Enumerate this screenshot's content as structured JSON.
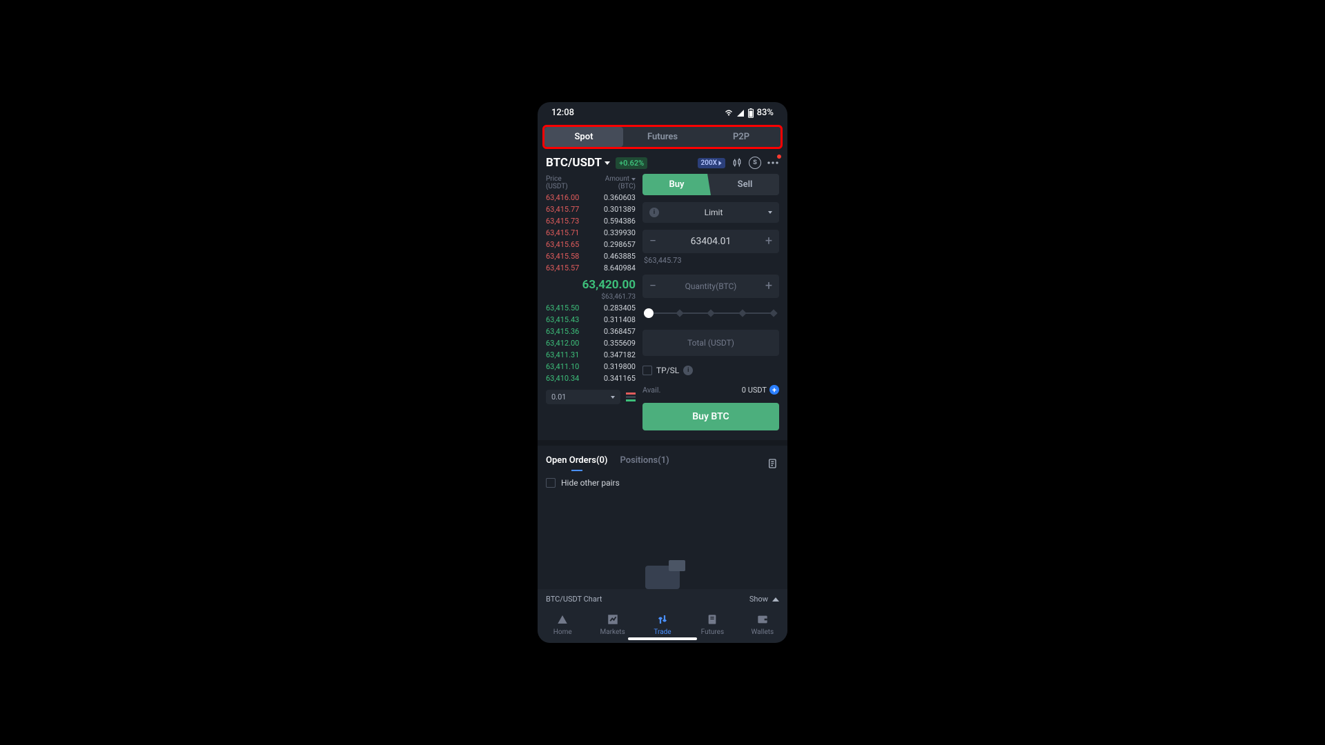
{
  "statusbar": {
    "time": "12:08",
    "battery": "83%"
  },
  "top_tabs": {
    "spot": "Spot",
    "futures": "Futures",
    "p2p": "P2P",
    "active": "Spot"
  },
  "pair": {
    "name": "BTC/USDT",
    "change": "+0.62%",
    "leverage": "200X"
  },
  "orderbook": {
    "head_price": "Price",
    "head_price_sub": "(USDT)",
    "head_amount": "Amount",
    "head_amount_sub": "(BTC)",
    "asks": [
      {
        "p": "63,416.00",
        "a": "0.360603"
      },
      {
        "p": "63,415.77",
        "a": "0.301389"
      },
      {
        "p": "63,415.73",
        "a": "0.594386"
      },
      {
        "p": "63,415.71",
        "a": "0.339930"
      },
      {
        "p": "63,415.65",
        "a": "0.298657"
      },
      {
        "p": "63,415.58",
        "a": "0.463885"
      },
      {
        "p": "63,415.57",
        "a": "8.640984"
      }
    ],
    "last": "63,420.00",
    "fiat": "$63,461.73",
    "bids": [
      {
        "p": "63,415.50",
        "a": "0.283405"
      },
      {
        "p": "63,415.43",
        "a": "0.311408"
      },
      {
        "p": "63,415.36",
        "a": "0.368457"
      },
      {
        "p": "63,412.00",
        "a": "0.355609"
      },
      {
        "p": "63,411.31",
        "a": "0.347182"
      },
      {
        "p": "63,411.10",
        "a": "0.319800"
      },
      {
        "p": "63,410.34",
        "a": "0.341165"
      }
    ],
    "depth": "0.01"
  },
  "panel": {
    "buy": "Buy",
    "sell": "Sell",
    "order_type": "Limit",
    "price": "63404.01",
    "fiat_price": "$63,445.73",
    "qty_placeholder": "Quantity(BTC)",
    "total_placeholder": "Total (USDT)",
    "tpsl": "TP/SL",
    "avail_label": "Avail.",
    "avail_value": "0 USDT",
    "action": "Buy BTC"
  },
  "orders": {
    "open_label": "Open Orders(0)",
    "positions_label": "Positions(1)",
    "hide_other": "Hide other pairs"
  },
  "chartbar": {
    "label": "BTC/USDT Chart",
    "toggle": "Show"
  },
  "nav": {
    "home": "Home",
    "markets": "Markets",
    "trade": "Trade",
    "futures": "Futures",
    "wallets": "Wallets",
    "active": "Trade"
  }
}
